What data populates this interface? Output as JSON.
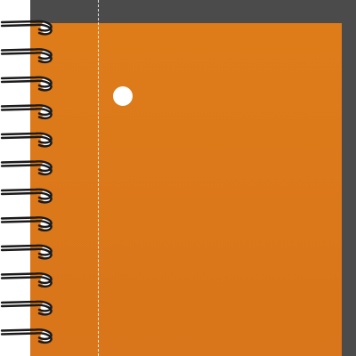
{
  "notebook": {
    "cover_color": "#d9781a",
    "back_cover_color": "#4b4b4b",
    "binding": "spiral-coil",
    "coil_count": 12
  }
}
